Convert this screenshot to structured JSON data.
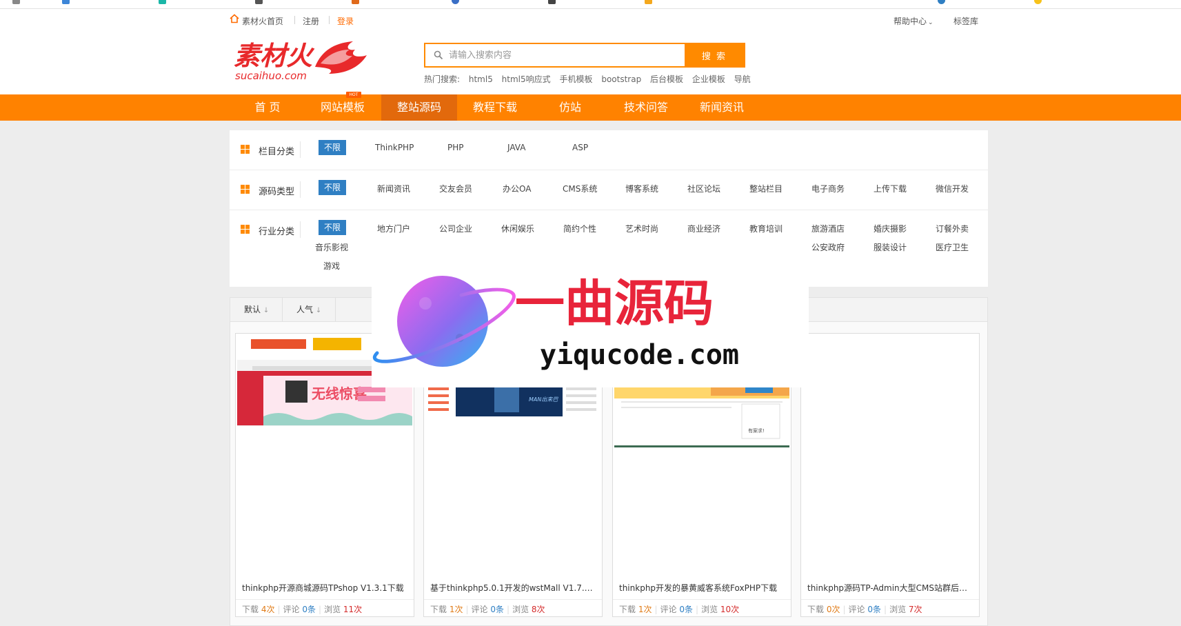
{
  "topbar": {
    "home_label": "素材火首页",
    "register_label": "注册",
    "login_label": "登录",
    "help_label": "帮助中心",
    "tags_label": "标签库"
  },
  "logo": {
    "brand_text": "素材火",
    "domain_text": "sucaihuo.com"
  },
  "search": {
    "placeholder": "请输入搜索内容",
    "button_label": "搜 索"
  },
  "hot": {
    "label": "热门搜索:",
    "items": [
      "html5",
      "html5响应式",
      "手机模板",
      "bootstrap",
      "后台模板",
      "企业模板",
      "导航"
    ]
  },
  "nav": {
    "items": [
      "首 页",
      "网站模板",
      "整站源码",
      "教程下载",
      "仿站",
      "技术问答",
      "新闻资讯"
    ],
    "active_index": 2,
    "hot_badge": "HOT"
  },
  "filters": {
    "any_label": "不限",
    "rows": [
      {
        "title": "栏目分类",
        "tags": [
          "ThinkPHP",
          "PHP",
          "JAVA",
          "ASP"
        ]
      },
      {
        "title": "源码类型",
        "tags": [
          "新闻资讯",
          "交友会员",
          "办公OA",
          "CMS系统",
          "博客系统",
          "社区论坛",
          "整站栏目",
          "电子商务",
          "上传下载",
          "微信开发"
        ]
      },
      {
        "title": "行业分类",
        "tags": [
          "地方门户",
          "公司企业",
          "休闲娱乐",
          "简约个性",
          "艺术时尚",
          "商业经济",
          "教育培训",
          "旅游酒店",
          "婚庆摄影",
          "订餐外卖"
        ],
        "tags_line2": [
          "音乐影视",
          "公安政府",
          "服装设计",
          "医疗卫生"
        ],
        "tags_line3": [
          "游戏"
        ]
      }
    ]
  },
  "sort": {
    "default_label": "默认",
    "popular_label": "人气"
  },
  "cards": [
    {
      "title": "thinkphp开源商城源码TPshop V1.3.1下载",
      "download_label": "下载",
      "downloads": "4次",
      "comment_label": "评论",
      "comments": "0条",
      "view_label": "浏览",
      "views": "11次"
    },
    {
      "title": "基于thinkphp5.0.1开发的wstMall V1.7.5...",
      "download_label": "下载",
      "downloads": "1次",
      "comment_label": "评论",
      "comments": "0条",
      "view_label": "浏览",
      "views": "8次"
    },
    {
      "title": "thinkphp开发的暴黄威客系统FoxPHP下载",
      "download_label": "下载",
      "downloads": "1次",
      "comment_label": "评论",
      "comments": "0条",
      "view_label": "浏览",
      "views": "10次"
    },
    {
      "title": "thinkphp源码TP-Admin大型CMS站群后台...",
      "download_label": "下载",
      "downloads": "0次",
      "comment_label": "评论",
      "comments": "0条",
      "view_label": "浏览",
      "views": "7次"
    }
  ],
  "thumb_texts": {
    "card1_banner": "无线惊喜",
    "card2_banner": "MAN出来巴",
    "card3_notice": "有案求!"
  },
  "watermark": {
    "title": "一曲源码",
    "url": "yiqucode.com"
  },
  "colors": {
    "brand_orange": "#ff8200",
    "active_nav": "#e2690c",
    "tag_blue": "#2f7fc3",
    "count_red": "#d42a2a"
  }
}
